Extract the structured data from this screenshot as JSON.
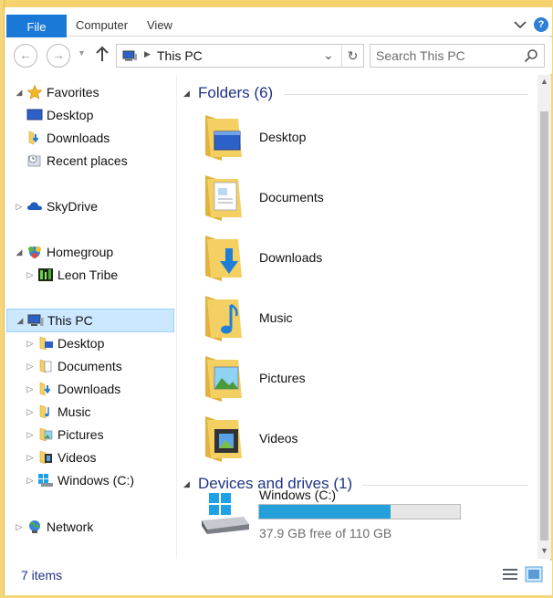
{
  "window": {
    "title": "This PC"
  },
  "ribbon": {
    "tabs": [
      {
        "label": "File"
      },
      {
        "label": "Computer"
      },
      {
        "label": "View"
      }
    ],
    "help": "?"
  },
  "navbar": {
    "back": "←",
    "forward": "→",
    "dropdown": "▼",
    "up": "🡑",
    "address": "This PC",
    "address_sep": "▶",
    "address_dd": "⌄",
    "refresh": "↻",
    "search_placeholder": "Search This PC"
  },
  "nav_pane": {
    "items": [
      {
        "label": "Favorites",
        "icon": "star-icon",
        "expander": "◢"
      },
      {
        "label": "Desktop",
        "icon": "desktop-icon"
      },
      {
        "label": "Downloads",
        "icon": "downloads-icon"
      },
      {
        "label": "Recent places",
        "icon": "recent-places-icon"
      },
      {
        "label": "SkyDrive",
        "icon": "skydrive-icon",
        "expander": "▷"
      },
      {
        "label": "Homegroup",
        "icon": "homegroup-icon",
        "expander": "◢"
      },
      {
        "label": "Leon Tribe",
        "icon": "user-icon",
        "expander": "▷"
      },
      {
        "label": "This PC",
        "icon": "pc-icon",
        "expander": "◢"
      },
      {
        "label": "Desktop",
        "icon": "desktop-folder-icon",
        "expander": "▷"
      },
      {
        "label": "Documents",
        "icon": "documents-icon",
        "expander": "▷"
      },
      {
        "label": "Downloads",
        "icon": "downloads-icon",
        "expander": "▷"
      },
      {
        "label": "Music",
        "icon": "music-icon",
        "expander": "▷"
      },
      {
        "label": "Pictures",
        "icon": "pictures-icon",
        "expander": "▷"
      },
      {
        "label": "Videos",
        "icon": "videos-icon",
        "expander": "▷"
      },
      {
        "label": "Windows (C:)",
        "icon": "drive-icon",
        "expander": "▷"
      },
      {
        "label": "Network",
        "icon": "network-icon",
        "expander": "▷"
      }
    ]
  },
  "content": {
    "folders_header": "Folders (6)",
    "folders": [
      {
        "label": "Desktop",
        "icon": "desktop-folder-icon"
      },
      {
        "label": "Documents",
        "icon": "documents-folder-icon"
      },
      {
        "label": "Downloads",
        "icon": "downloads-folder-icon"
      },
      {
        "label": "Music",
        "icon": "music-folder-icon"
      },
      {
        "label": "Pictures",
        "icon": "pictures-folder-icon"
      },
      {
        "label": "Videos",
        "icon": "videos-folder-icon"
      }
    ],
    "drives_header": "Devices and drives (1)",
    "drive": {
      "name": "Windows (C:)",
      "free_text": "37.9 GB free of 110 GB",
      "used_fraction": 0.655
    },
    "collapse_glyph": "◢"
  },
  "status": {
    "items_text": "7 items"
  },
  "colors": {
    "accent": "#1a79d6",
    "group_title": "#1e3287",
    "progress": "#26a0da",
    "folder": "#f4cf62",
    "folder_dark": "#e2b23e"
  }
}
